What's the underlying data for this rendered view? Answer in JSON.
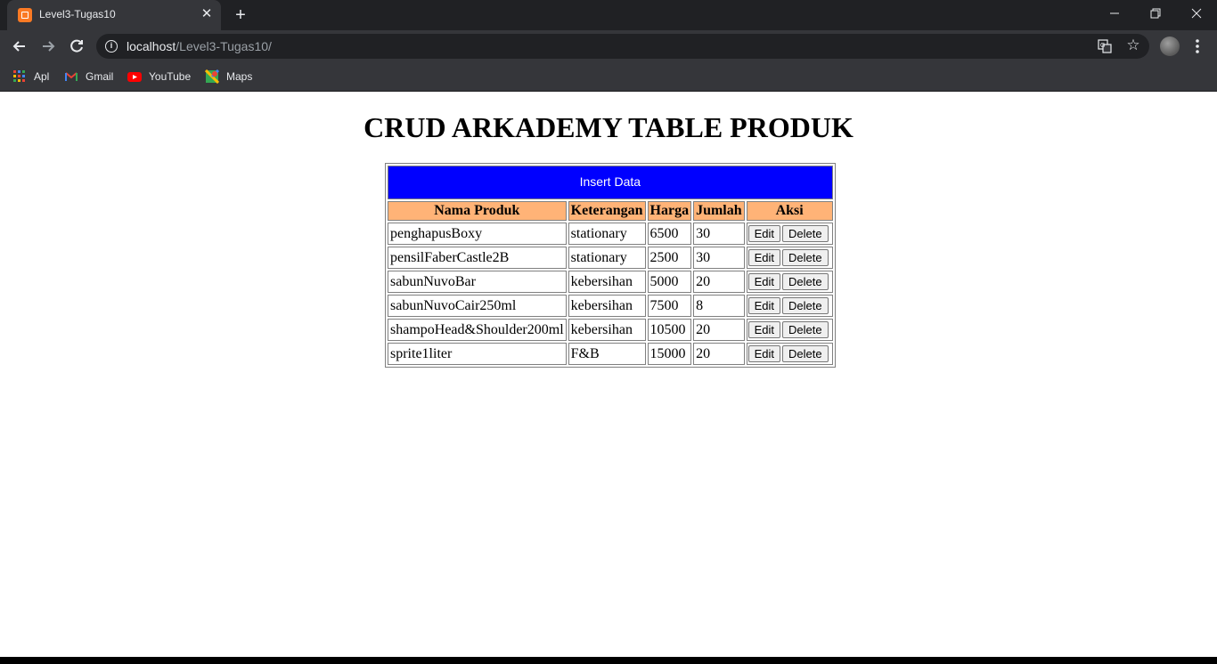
{
  "browser": {
    "tab_title": "Level3-Tugas10",
    "url_host": "localhost",
    "url_path": "/Level3-Tugas10/",
    "bookmarks": [
      "Apl",
      "Gmail",
      "YouTube",
      "Maps"
    ]
  },
  "page": {
    "title": "CRUD ARKADEMY TABLE PRODUK",
    "insert_label": "Insert Data",
    "columns": [
      "Nama Produk",
      "Keterangan",
      "Harga",
      "Jumlah",
      "Aksi"
    ],
    "rows": [
      {
        "nama": "penghapusBoxy",
        "keterangan": "stationary",
        "harga": "6500",
        "jumlah": "30"
      },
      {
        "nama": "pensilFaberCastle2B",
        "keterangan": "stationary",
        "harga": "2500",
        "jumlah": "30"
      },
      {
        "nama": "sabunNuvoBar",
        "keterangan": "kebersihan",
        "harga": "5000",
        "jumlah": "20"
      },
      {
        "nama": "sabunNuvoCair250ml",
        "keterangan": "kebersihan",
        "harga": "7500",
        "jumlah": "8"
      },
      {
        "nama": "shampoHead&Shoulder200ml",
        "keterangan": "kebersihan",
        "harga": "10500",
        "jumlah": "20"
      },
      {
        "nama": "sprite1liter",
        "keterangan": "F&B",
        "harga": "15000",
        "jumlah": "20"
      }
    ],
    "edit_label": "Edit",
    "delete_label": "Delete"
  },
  "colors": {
    "insert_bg": "#0000ff",
    "header_bg": "#ffb377"
  }
}
